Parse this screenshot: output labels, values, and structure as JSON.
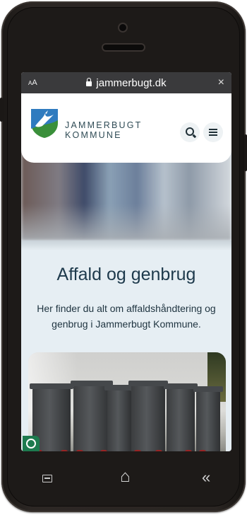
{
  "browser": {
    "text_size_label": "AA",
    "url": "jammerbugt.dk",
    "close_symbol": "×"
  },
  "header": {
    "brand_line1": "JAMMERBUGT",
    "brand_line2": "KOMMUNE",
    "logo_icon": "jammerbugt-bird-shield-logo",
    "search_icon": "search-icon",
    "menu_icon": "menu-icon"
  },
  "page": {
    "title": "Affald og genbrug",
    "intro": "Her finder du alt om affaldshåndtering og genbrug i Jammerbugt Kommune."
  },
  "android_nav": {
    "home_symbol": "⌂",
    "back_symbol": "«"
  },
  "colors": {
    "brand_text": "#2f4b55",
    "title": "#1e3a4c",
    "page_bg": "#e6eef3",
    "url_bar": "#3a3a3c"
  }
}
